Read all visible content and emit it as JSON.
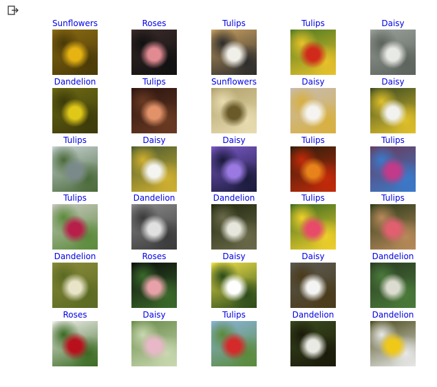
{
  "cell_output_icon": "output-exit-icon",
  "flowers": [
    [
      {
        "label": "Sunflowers",
        "bg": "#8a6a12",
        "accent": "#e6b312",
        "accent2": "#4a3a08",
        "kind": "sunflower-field"
      },
      {
        "label": "Roses",
        "bg": "#3a2a2a",
        "accent": "#e28a92",
        "accent2": "#111111",
        "kind": "rose-frame"
      },
      {
        "label": "Tulips",
        "bg": "#c8a060",
        "accent": "#f0efe8",
        "accent2": "#2c2c2c",
        "kind": "tulip-poster"
      },
      {
        "label": "Tulips",
        "bg": "#4e7a22",
        "accent": "#d12a1a",
        "accent2": "#e8c22a",
        "kind": "tulip-field"
      },
      {
        "label": "Daisy",
        "bg": "#9aa09a",
        "accent": "#e8eae6",
        "accent2": "#5c625c",
        "kind": "daisy-closeup"
      }
    ],
    [
      {
        "label": "Dandelion",
        "bg": "#6d6a14",
        "accent": "#e0c818",
        "accent2": "#3c3a0a",
        "kind": "dandelion-field"
      },
      {
        "label": "Tulips",
        "bg": "#2a1410",
        "accent": "#e29268",
        "accent2": "#6a3a22",
        "kind": "tulip-pair"
      },
      {
        "label": "Sunflowers",
        "bg": "#b0a06a",
        "accent": "#6a5a2a",
        "accent2": "#e8dcb0",
        "kind": "sunflower-vase"
      },
      {
        "label": "Daisy",
        "bg": "#c6bcb4",
        "accent": "#f6f4f0",
        "accent2": "#d8b040",
        "kind": "daisy-single"
      },
      {
        "label": "Daisy",
        "bg": "#3a4a22",
        "accent": "#f2f2ee",
        "accent2": "#e0c02a",
        "kind": "daisy-dark"
      }
    ],
    [
      {
        "label": "Tulips",
        "bg": "#c8d2d4",
        "accent": "#7a8a8a",
        "accent2": "#4a6a3a",
        "kind": "tulip-city"
      },
      {
        "label": "Daisy",
        "bg": "#4a5a30",
        "accent": "#f4f4f0",
        "accent2": "#d0b030",
        "kind": "daisy-garden"
      },
      {
        "label": "Daisy",
        "bg": "#7a5ac8",
        "accent": "#9a7ae2",
        "accent2": "#1a1a3a",
        "kind": "daisy-purple"
      },
      {
        "label": "Tulips",
        "bg": "#2a1e0c",
        "accent": "#e8821a",
        "accent2": "#c42a0a",
        "kind": "tulip-orange"
      },
      {
        "label": "Tulips",
        "bg": "#6a3a5a",
        "accent": "#c23a8a",
        "accent2": "#3a7aca",
        "kind": "tulip-purple-field"
      }
    ],
    [
      {
        "label": "Tulips",
        "bg": "#c8c8c0",
        "accent": "#b81e4a",
        "accent2": "#5a8a3a",
        "kind": "tulip-single-red"
      },
      {
        "label": "Dandelion",
        "bg": "#8a8a8a",
        "accent": "#e0e0e0",
        "accent2": "#3a3a3a",
        "kind": "dandelion-bw"
      },
      {
        "label": "Dandelion",
        "bg": "#22280e",
        "accent": "#e6e6dc",
        "accent2": "#6a6a4a",
        "kind": "dandelion-seedhead"
      },
      {
        "label": "Tulips",
        "bg": "#3a6a22",
        "accent": "#e84a6a",
        "accent2": "#f0d02a",
        "kind": "tulip-market"
      },
      {
        "label": "Tulips",
        "bg": "#2a3a1a",
        "accent": "#e06070",
        "accent2": "#b88a5a",
        "kind": "tulip-garden"
      }
    ],
    [
      {
        "label": "Dandelion",
        "bg": "#8a8a3a",
        "accent": "#e8e4c8",
        "accent2": "#5a6a22",
        "kind": "dandelion-meadow"
      },
      {
        "label": "Roses",
        "bg": "#0c0c0c",
        "accent": "#e6a2a8",
        "accent2": "#3a6a2a",
        "kind": "rose-black"
      },
      {
        "label": "Daisy",
        "bg": "#f0e24a",
        "accent": "#ffffff",
        "accent2": "#2a4a1a",
        "kind": "daisy-yellow"
      },
      {
        "label": "Daisy",
        "bg": "#5a5a52",
        "accent": "#f4f4f2",
        "accent2": "#4a3a1a",
        "kind": "daisy-white"
      },
      {
        "label": "Dandelion",
        "bg": "#2a3a22",
        "accent": "#dcdcd0",
        "accent2": "#4a7a3a",
        "kind": "dandelion-dusk"
      }
    ],
    [
      {
        "label": "Roses",
        "bg": "#f2f0ee",
        "accent": "#b8101c",
        "accent2": "#3a6a22",
        "kind": "roses-red"
      },
      {
        "label": "Daisy",
        "bg": "#6a8a4a",
        "accent": "#e8b8c8",
        "accent2": "#c8d8b0",
        "kind": "daisy-pink"
      },
      {
        "label": "Tulips",
        "bg": "#8ab4dc",
        "accent": "#d42a2a",
        "accent2": "#5a8a3a",
        "kind": "tulip-sky"
      },
      {
        "label": "Dandelion",
        "bg": "#3a4a1e",
        "accent": "#eaeae4",
        "accent2": "#1a1a0a",
        "kind": "dandelion-puff"
      },
      {
        "label": "Dandelion",
        "bg": "#4a4a1a",
        "accent": "#f0c818",
        "accent2": "#e8e8e8",
        "kind": "dandelion-butterfly"
      }
    ]
  ]
}
